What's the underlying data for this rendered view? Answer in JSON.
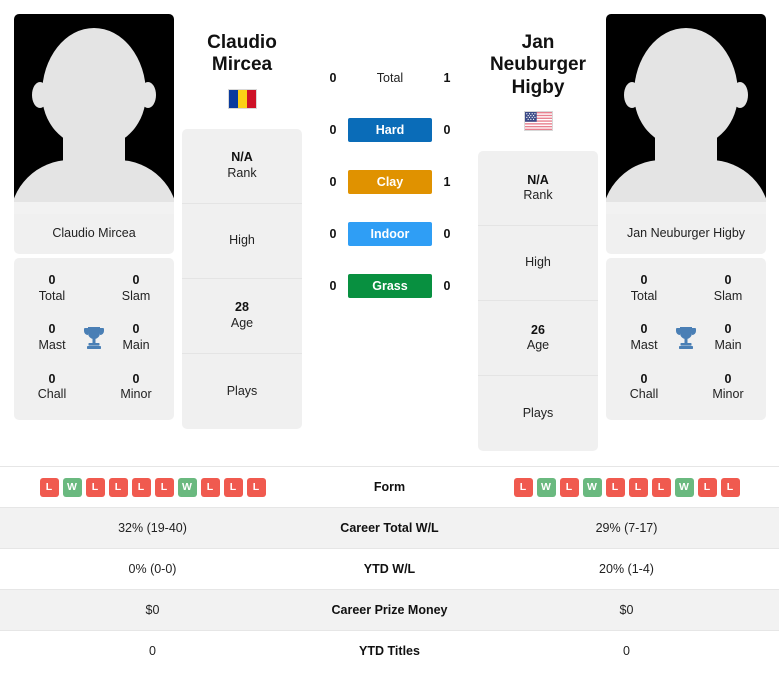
{
  "players": {
    "left": {
      "first_name": "Claudio",
      "last_name": "Mircea",
      "full_name": "Claudio Mircea",
      "country": "Romania",
      "flag_icon": "flag-romania-icon",
      "avatar_icon": "player-silhouette-icon",
      "rank": "N/A",
      "rank_label": "Rank",
      "high_label": "High",
      "high_value": "",
      "age": "28",
      "age_label": "Age",
      "plays_label": "Plays",
      "plays_value": "",
      "titles": [
        {
          "value": "0",
          "label": "Total"
        },
        {
          "value": "0",
          "label": "Slam"
        },
        {
          "value": "0",
          "label": "Mast"
        },
        {
          "value": "0",
          "label": "Main"
        },
        {
          "value": "0",
          "label": "Chall"
        },
        {
          "value": "0",
          "label": "Minor"
        }
      ]
    },
    "right": {
      "first_name": "Jan Neuburger",
      "last_name": "Higby",
      "full_name": "Jan Neuburger Higby",
      "country": "United States",
      "flag_icon": "flag-usa-icon",
      "avatar_icon": "player-silhouette-icon",
      "rank": "N/A",
      "rank_label": "Rank",
      "high_label": "High",
      "high_value": "",
      "age": "26",
      "age_label": "Age",
      "plays_label": "Plays",
      "plays_value": "",
      "titles": [
        {
          "value": "0",
          "label": "Total"
        },
        {
          "value": "0",
          "label": "Slam"
        },
        {
          "value": "0",
          "label": "Mast"
        },
        {
          "value": "0",
          "label": "Main"
        },
        {
          "value": "0",
          "label": "Chall"
        },
        {
          "value": "0",
          "label": "Minor"
        }
      ]
    }
  },
  "trophy_icon": "trophy-icon",
  "trophy_color": "#4a7fb5",
  "h2h": [
    {
      "label": "Total",
      "left": "0",
      "right": "1",
      "style": "plain",
      "color": ""
    },
    {
      "label": "Hard",
      "left": "0",
      "right": "0",
      "style": "surface",
      "color": "#0a6cb8"
    },
    {
      "label": "Clay",
      "left": "0",
      "right": "1",
      "style": "surface",
      "color": "#e09200"
    },
    {
      "label": "Indoor",
      "left": "0",
      "right": "0",
      "style": "surface",
      "color": "#2f9ef5"
    },
    {
      "label": "Grass",
      "left": "0",
      "right": "0",
      "style": "surface",
      "color": "#089040"
    }
  ],
  "table": {
    "form": {
      "label": "Form",
      "left": [
        "L",
        "W",
        "L",
        "L",
        "L",
        "L",
        "W",
        "L",
        "L",
        "L"
      ],
      "right": [
        "L",
        "W",
        "L",
        "W",
        "L",
        "L",
        "L",
        "W",
        "L",
        "L"
      ]
    },
    "rows": [
      {
        "label": "Career Total W/L",
        "left": "32% (19-40)",
        "right": "29% (7-17)"
      },
      {
        "label": "YTD W/L",
        "left": "0% (0-0)",
        "right": "20% (1-4)"
      },
      {
        "label": "Career Prize Money",
        "left": "$0",
        "right": "$0"
      },
      {
        "label": "YTD Titles",
        "left": "0",
        "right": "0"
      }
    ]
  },
  "colors": {
    "win_badge": "#6ab97f",
    "loss_badge": "#f05a4f",
    "card_bg": "#f0f0f0",
    "row_alt_bg": "#f2f2f2"
  }
}
